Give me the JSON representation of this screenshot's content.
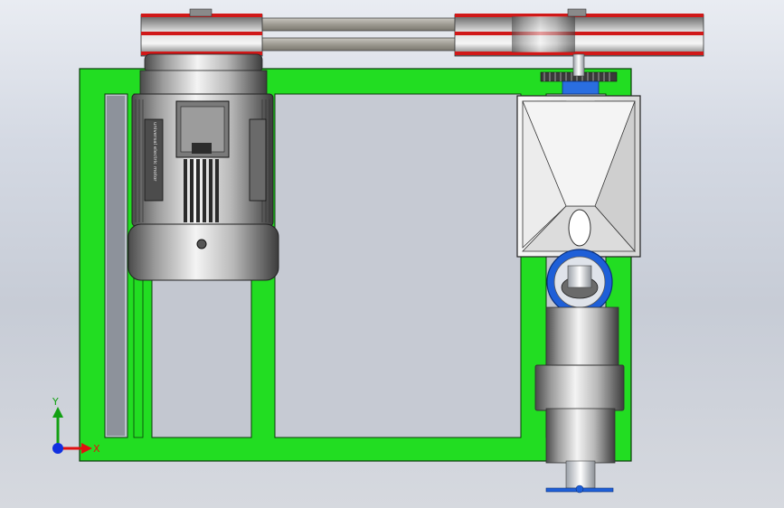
{
  "scene": {
    "description_hidden": "",
    "motor_label": "universal electric motor",
    "colors": {
      "background_top": "#e9ecf2",
      "frame": "#22dd22",
      "frame_edge": "#0a3a0a",
      "belt": "#9a9890",
      "pulley_rim": "#d01818",
      "bearing_ring": "#1e5fd8",
      "metal_light": "#f2f2f2",
      "metal_dark": "#5a5a5a"
    }
  },
  "triad": {
    "x_label": "X",
    "y_label": "Y",
    "x_color": "#e01010",
    "y_color": "#12a012",
    "z_color": "#1030e0"
  }
}
